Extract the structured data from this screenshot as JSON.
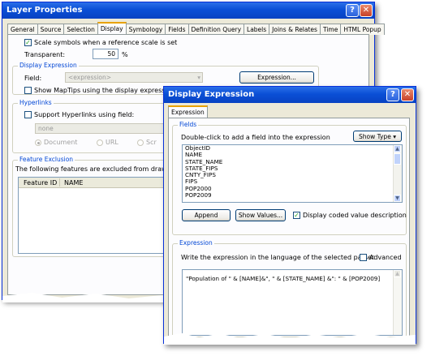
{
  "layer_properties": {
    "title": "Layer Properties",
    "tabs": [
      "General",
      "Source",
      "Selection",
      "Display",
      "Symbology",
      "Fields",
      "Definition Query",
      "Labels",
      "Joins & Relates",
      "Time",
      "HTML Popup"
    ],
    "active_tab": "Display",
    "scale_symbols_label": "Scale symbols when a reference scale is set",
    "scale_symbols_checked": true,
    "transparent_label": "Transparent:",
    "transparent_value": "50",
    "percent_unit": "%",
    "display_expression_group": "Display Expression",
    "field_label": "Field:",
    "field_value": "<expression>",
    "expression_button": "Expression...",
    "show_maptips_label": "Show MapTips using the display expression",
    "hyperlinks_group": "Hyperlinks",
    "support_hyperlinks_label": "Support Hyperlinks using field:",
    "hyperlink_field_value": "none",
    "radio_document": "Document",
    "radio_url": "URL",
    "radio_script": "Scr",
    "feature_exclusion_group": "Feature Exclusion",
    "exclusion_text": "The following features are excluded from drawing:",
    "col_feature_id": "Feature ID",
    "col_name": "NAME"
  },
  "display_expression": {
    "title": "Display Expression",
    "tab_label": "Expression",
    "fields_group": "Fields",
    "fields_hint": "Double-click to add a field into the expression",
    "show_type_button": "Show Type",
    "fields": [
      "ObjectID",
      "NAME",
      "STATE_NAME",
      "STATE_FIPS",
      "CNTY_FIPS",
      "FIPS",
      "POP2000",
      "POP2009"
    ],
    "append_button": "Append",
    "show_values_button": "Show Values...",
    "display_coded_label": "Display coded value description",
    "display_coded_checked": true,
    "expression_group": "Expression",
    "expression_hint": "Write the expression in the language of the selected parser.",
    "advanced_label": "Advanced",
    "advanced_checked": false,
    "expression_text": "\"Population of \" & [NAME]&\", \" & [STATE_NAME] &\": \" & [POP2009]"
  }
}
